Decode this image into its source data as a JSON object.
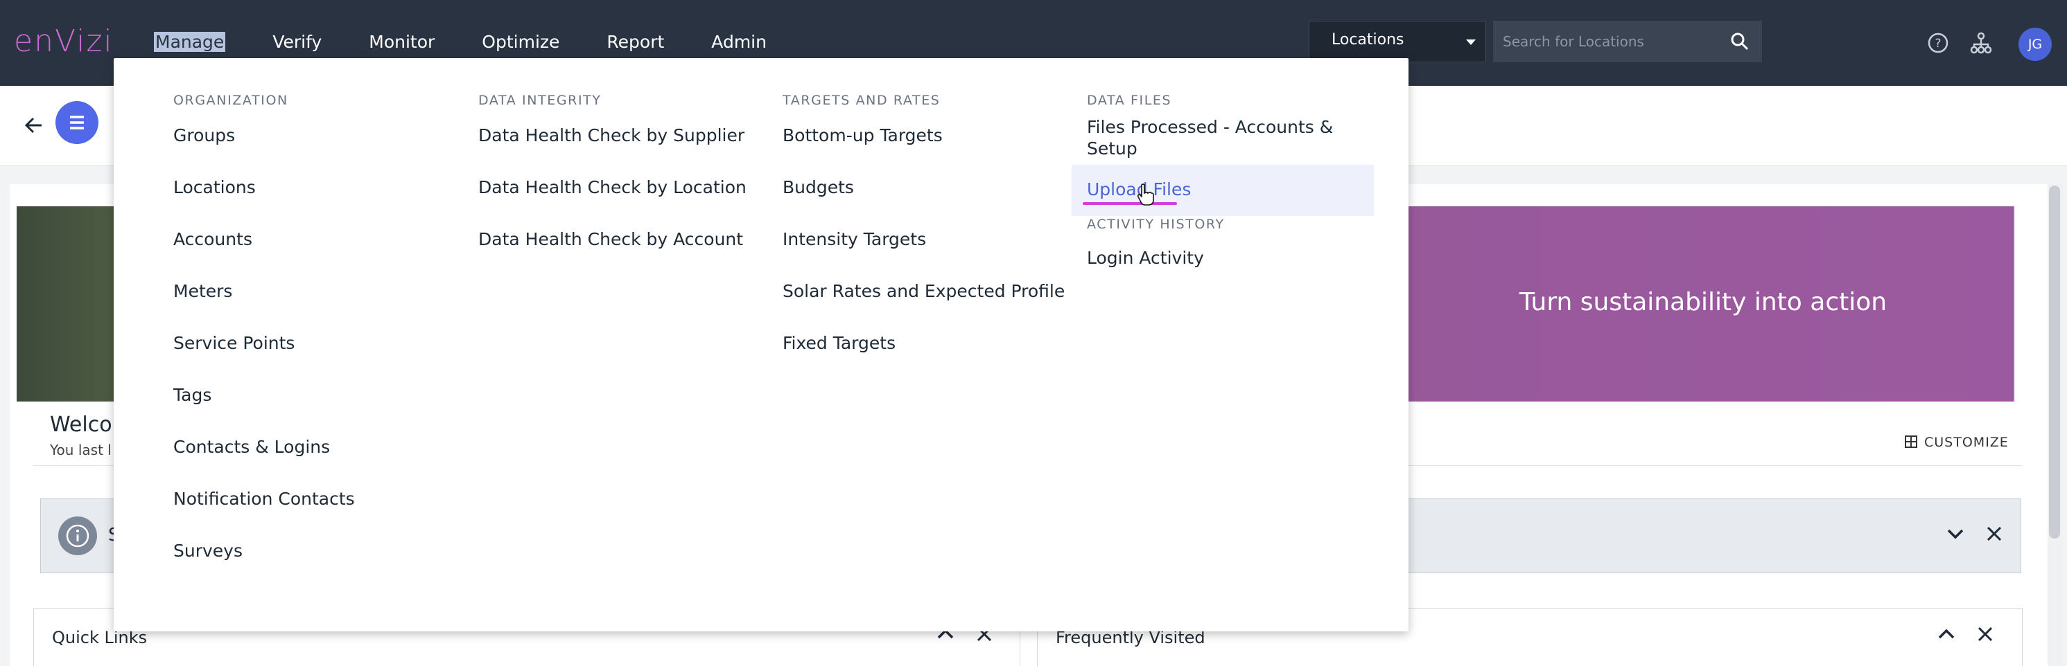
{
  "brand": {
    "logo_text": "enVizi",
    "accent": "#d23cd8",
    "primary": "#4a63d9"
  },
  "nav": {
    "items": [
      "Manage",
      "Verify",
      "Monitor",
      "Optimize",
      "Report",
      "Admin"
    ],
    "active": "Manage"
  },
  "header": {
    "locations_select": "Locations",
    "search_placeholder": "Search for Locations",
    "avatar_initials": "JG",
    "icons": [
      "help-icon",
      "hierarchy-icon"
    ]
  },
  "mega_menu": {
    "organization": {
      "heading": "ORGANIZATION",
      "items": [
        "Groups",
        "Locations",
        "Accounts",
        "Meters",
        "Service Points",
        "Tags",
        "Contacts & Logins",
        "Notification Contacts",
        "Surveys"
      ]
    },
    "data_integrity": {
      "heading": "DATA INTEGRITY",
      "items": [
        "Data Health Check by Supplier",
        "Data Health Check by Location",
        "Data Health Check by Account"
      ]
    },
    "targets_rates": {
      "heading": "TARGETS AND RATES",
      "items": [
        "Bottom-up Targets",
        "Budgets",
        "Intensity Targets",
        "Solar Rates and Expected Profile",
        "Fixed Targets"
      ]
    },
    "data_files": {
      "heading": "DATA FILES",
      "items": [
        "Files Processed - Accounts & Setup",
        "Upload Files"
      ]
    },
    "activity_history": {
      "heading": "ACTIVITY HISTORY",
      "items": [
        "Login Activity"
      ]
    }
  },
  "page": {
    "hero_text": "Turn sustainability into action",
    "welcome": "Welco",
    "last_login": "You last l",
    "customize": "CUSTOMIZE",
    "notice_letter": "S",
    "quick_links": "Quick Links",
    "frequently_visited": "Frequently Visited"
  }
}
